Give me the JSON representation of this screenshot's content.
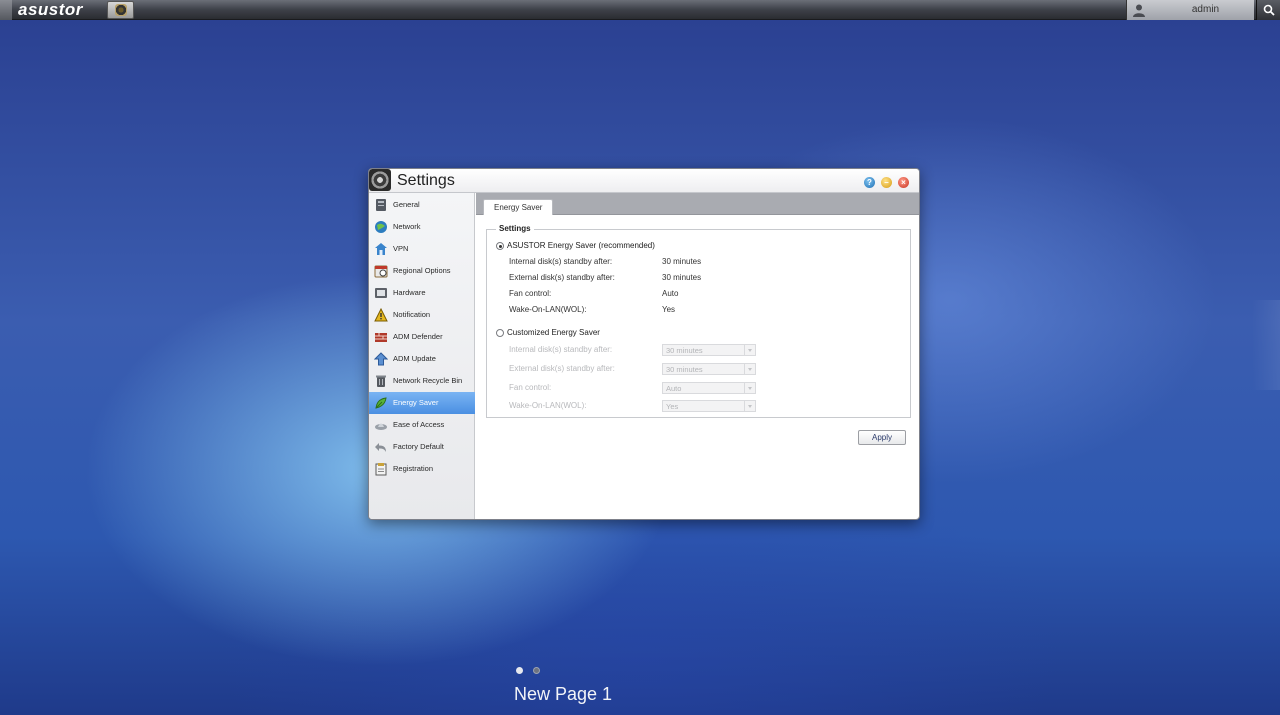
{
  "topbar": {
    "logo": "asustor",
    "user_name": "admin"
  },
  "window": {
    "title": "Settings"
  },
  "sidebar": {
    "items": [
      {
        "label": "General",
        "icon": "general-icon"
      },
      {
        "label": "Network",
        "icon": "network-icon"
      },
      {
        "label": "VPN",
        "icon": "vpn-icon"
      },
      {
        "label": "Regional Options",
        "icon": "regional-options-icon"
      },
      {
        "label": "Hardware",
        "icon": "hardware-icon"
      },
      {
        "label": "Notification",
        "icon": "notification-icon"
      },
      {
        "label": "ADM Defender",
        "icon": "adm-defender-icon"
      },
      {
        "label": "ADM Update",
        "icon": "adm-update-icon"
      },
      {
        "label": "Network Recycle Bin",
        "icon": "recycle-bin-icon"
      },
      {
        "label": "Energy Saver",
        "icon": "energy-saver-icon",
        "active": true
      },
      {
        "label": "Ease of Access",
        "icon": "ease-of-access-icon"
      },
      {
        "label": "Factory Default",
        "icon": "factory-default-icon"
      },
      {
        "label": "Registration",
        "icon": "registration-icon"
      }
    ]
  },
  "tabs": [
    {
      "label": "Energy Saver"
    }
  ],
  "settings": {
    "legend": "Settings",
    "recommended": {
      "label": "ASUSTOR Energy Saver (recommended)",
      "selected": true,
      "rows": [
        {
          "label": "Internal disk(s) standby after:",
          "value": "30 minutes"
        },
        {
          "label": "External disk(s) standby after:",
          "value": "30 minutes"
        },
        {
          "label": "Fan control:",
          "value": "Auto"
        },
        {
          "label": "Wake-On-LAN(WOL):",
          "value": "Yes"
        }
      ]
    },
    "custom": {
      "label": "Customized Energy Saver",
      "selected": false,
      "rows": [
        {
          "label": "Internal disk(s) standby after:",
          "value": "30 minutes"
        },
        {
          "label": "External disk(s) standby after:",
          "value": "30 minutes"
        },
        {
          "label": "Fan control:",
          "value": "Auto"
        },
        {
          "label": "Wake-On-LAN(WOL):",
          "value": "Yes"
        }
      ]
    }
  },
  "apply_label": "Apply",
  "desktop": {
    "page_label": "New Page 1"
  },
  "colors": {
    "accent": "#4a8fe2",
    "help": "#1e6fb3",
    "minimize": "#d69a12",
    "close": "#c8321f"
  }
}
